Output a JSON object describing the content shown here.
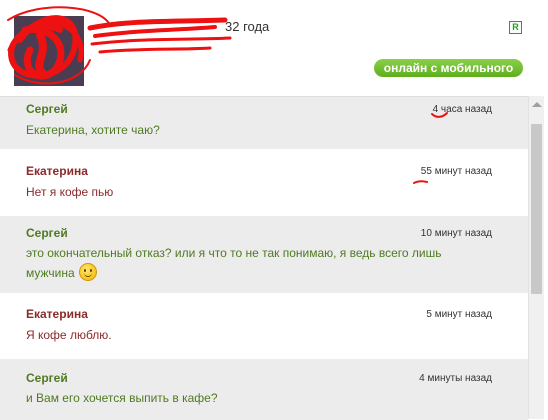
{
  "header": {
    "age_text": "32 года",
    "r_badge": "R",
    "status": "онлайн с мобильного"
  },
  "messages": [
    {
      "author": "Сергей",
      "time": "4 часа назад",
      "text": "Екатерина, хотите чаю?"
    },
    {
      "author": "Екатерина",
      "time": "55 минут назад",
      "text": "Нет я кофе пью"
    },
    {
      "author": "Сергей",
      "time": "10 минут назад",
      "text_line1": "это окончательный отказ? или я что то не так понимаю, я ведь всего лишь",
      "text_line2": "мужчина"
    },
    {
      "author": "Екатерина",
      "time": "5 минут назад",
      "text": "Я кофе люблю."
    },
    {
      "author": "Сергей",
      "time": "4 минуты назад",
      "text": "и Вам его хочется выпить в кафе?"
    }
  ],
  "colors": {
    "male": "#4f7a22",
    "female": "#8b2a2a",
    "alt_row": "#ececec",
    "online_badge": "#6cbb2a",
    "annotation_red": "#ee1111"
  },
  "icons": [
    "r-badge-icon",
    "smiley-icon",
    "scroll-up-arrow-icon"
  ]
}
